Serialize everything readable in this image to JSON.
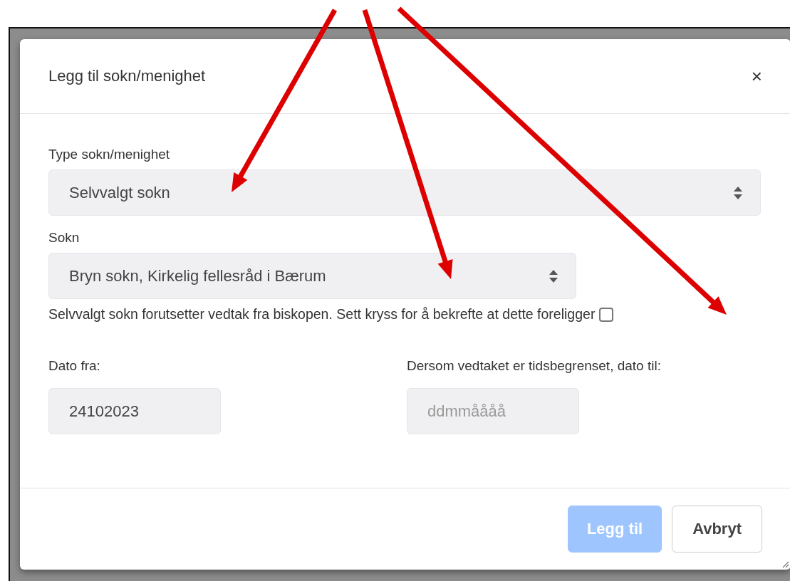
{
  "dialog": {
    "title": "Legg til sokn/menighet",
    "close": "×"
  },
  "fields": [
    {
      "label": "Type sokn/menighet",
      "value": "Selvvalgt sokn"
    },
    {
      "label": "Sokn",
      "value": "Bryn sokn, Kirkelig fellesråd i Bærum"
    }
  ],
  "confirm": {
    "label": "Selvvalgt sokn forutsetter vedtak fra biskopen. Sett kryss for å bekrefte at dette foreligger",
    "checked": false
  },
  "dates": [
    {
      "label": "Dato fra:",
      "value": "24102023"
    },
    {
      "label": "Dersom vedtaket er tidsbegrenset, dato til:",
      "placeholder": "ddmmåååå"
    }
  ],
  "buttons": [
    {
      "label": "Legg til",
      "kind": "primary",
      "disabled": true
    },
    {
      "label": "Avbryt",
      "kind": "secondary",
      "disabled": false
    }
  ]
}
